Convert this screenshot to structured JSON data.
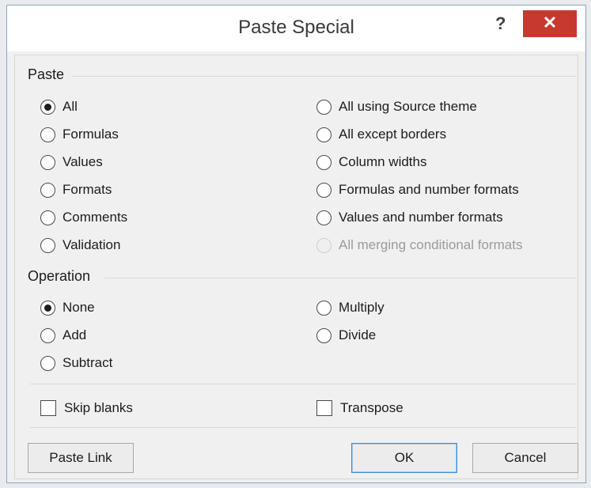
{
  "dialog": {
    "title": "Paste Special",
    "help_label": "?",
    "close_label": "✕"
  },
  "paste": {
    "label": "Paste",
    "selected": "All",
    "options_left": [
      "All",
      "Formulas",
      "Values",
      "Formats",
      "Comments",
      "Validation"
    ],
    "options_right": [
      "All using Source theme",
      "All except borders",
      "Column widths",
      "Formulas and number formats",
      "Values and number formats",
      "All merging conditional formats"
    ],
    "disabled": [
      "All merging conditional formats"
    ]
  },
  "operation": {
    "label": "Operation",
    "selected": "None",
    "options_left": [
      "None",
      "Add",
      "Subtract"
    ],
    "options_right": [
      "Multiply",
      "Divide"
    ]
  },
  "checkboxes": {
    "skip_blanks": "Skip blanks",
    "skip_blanks_checked": false,
    "transpose": "Transpose",
    "transpose_checked": false
  },
  "buttons": {
    "paste_link": "Paste Link",
    "ok": "OK",
    "cancel": "Cancel"
  },
  "colors": {
    "close_button": "#c7392f",
    "default_button_border": "#3f8fd2"
  }
}
